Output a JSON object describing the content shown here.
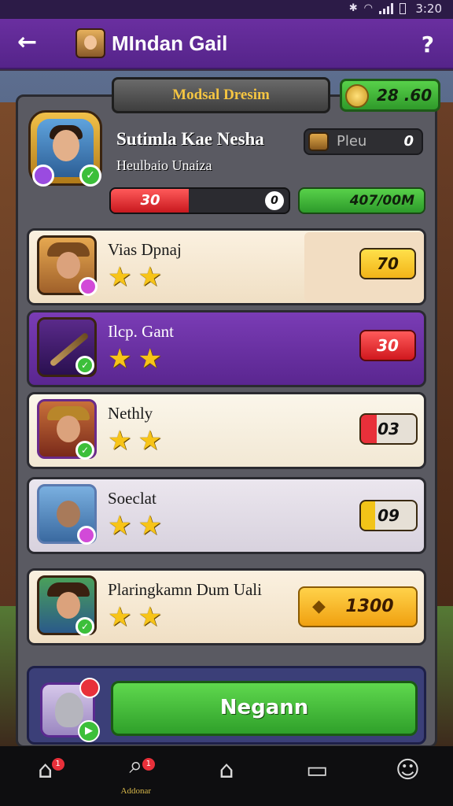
{
  "status_bar": {
    "time": "3:20"
  },
  "app_bar": {
    "back_icon": "←",
    "title": "MIndan Gail",
    "help_icon": "?"
  },
  "header": {
    "ribbon_title": "Modsal Dresim",
    "currency_value": "28 .60"
  },
  "profile": {
    "name": "Sutimla  Kae  Nesha",
    "subtitle": "Heulbaio Unaiza",
    "field_label": "Pleu",
    "field_value": "0",
    "health_value": "30",
    "health_max_badge": "0",
    "health_fraction": 0.44,
    "xp_value": "407/00M"
  },
  "cards": [
    {
      "name": "Vias Dpnaj",
      "stars": 2,
      "value": "70",
      "style": "cream"
    },
    {
      "name": "Ilcp. Gant",
      "stars": 2,
      "value": "30",
      "style": "purple"
    },
    {
      "name": "Nethly",
      "stars": 2,
      "value": "03",
      "style": "white"
    },
    {
      "name": "Soeclat",
      "stars": 2,
      "value": "09",
      "style": "gray"
    },
    {
      "name": "Plaringkamn Dum Uali",
      "stars": 2,
      "value": "1300",
      "style": "cream"
    }
  ],
  "action": {
    "button_label": "Negann"
  },
  "nav": [
    {
      "icon": "home-icon",
      "badge": "1"
    },
    {
      "icon": "search-icon",
      "badge": "1",
      "label": "Addonar"
    },
    {
      "icon": "house-outline-icon"
    },
    {
      "icon": "chat-icon"
    },
    {
      "icon": "profile-icon"
    }
  ],
  "colors": {
    "accent": "#6a2fa0",
    "green": "#3cbf3a",
    "gold": "#f7c418",
    "red": "#e8303a"
  }
}
